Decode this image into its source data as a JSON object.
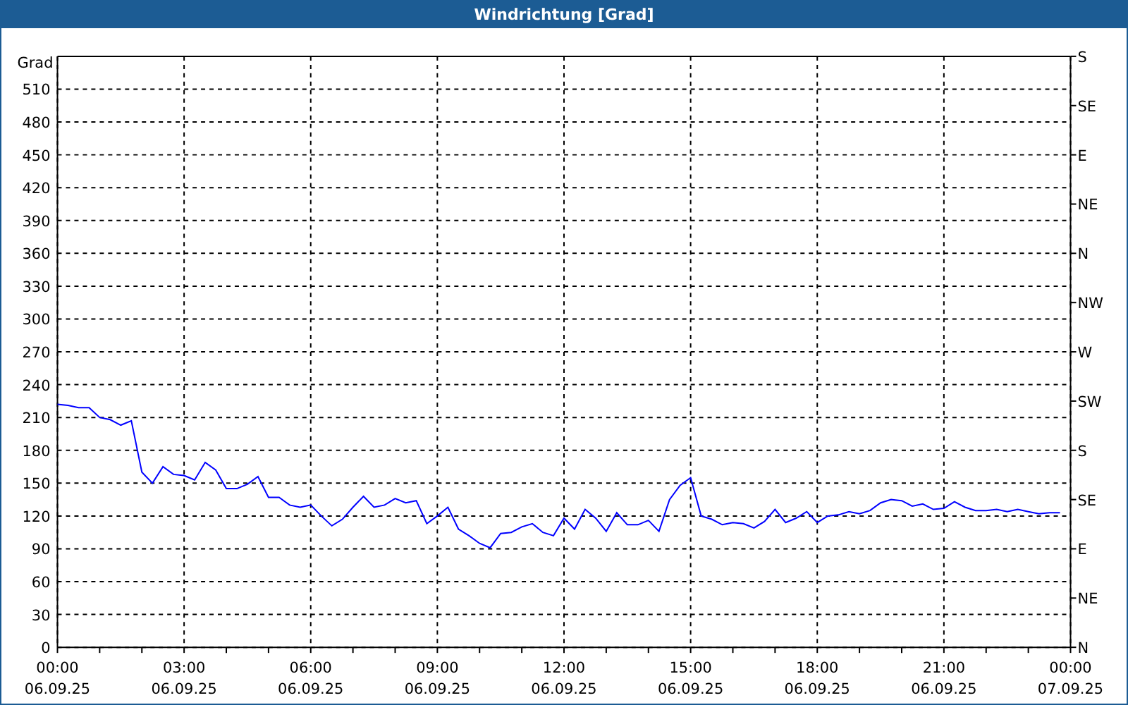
{
  "window": {
    "title": "Windrichtung [Grad]"
  },
  "chart": {
    "chart_data": {
      "type": "line",
      "grid": true,
      "ylabel": "Grad",
      "ylim": [
        0,
        540
      ],
      "yticks": [
        0,
        30,
        60,
        90,
        120,
        150,
        180,
        210,
        240,
        270,
        300,
        330,
        360,
        390,
        420,
        450,
        480,
        510
      ],
      "categories": [
        "00:00 06.09.25",
        null,
        null,
        null,
        null,
        null,
        null,
        null,
        null,
        null,
        null,
        null,
        "03:00 06.09.25",
        null,
        null,
        null,
        null,
        null,
        null,
        null,
        null,
        null,
        null,
        null,
        "06:00 06.09.25",
        null,
        null,
        null,
        null,
        null,
        null,
        null,
        null,
        null,
        null,
        null,
        "09:00 06.09.25",
        null,
        null,
        null,
        null,
        null,
        null,
        null,
        null,
        null,
        null,
        null,
        "12:00 06.09.25",
        null,
        null,
        null,
        null,
        null,
        null,
        null,
        null,
        null,
        null,
        null,
        "15:00 06.09.25",
        null,
        null,
        null,
        null,
        null,
        null,
        null,
        null,
        null,
        null,
        null,
        "18:00 06.09.25",
        null,
        null,
        null,
        null,
        null,
        null,
        null,
        null,
        null,
        null,
        null,
        "21:00 06.09.25",
        null,
        null,
        null,
        null,
        null,
        null,
        null,
        null,
        null,
        null,
        null,
        "00:00 07.09.25"
      ],
      "series": [
        {
          "color": "#0000ff",
          "values": [
            222,
            221,
            219,
            219,
            210,
            208,
            203,
            207,
            160,
            150,
            165,
            158,
            157,
            153,
            169,
            162,
            145,
            145,
            149,
            156,
            137,
            137,
            130,
            128,
            130,
            120,
            111,
            117,
            128,
            138,
            128,
            130,
            136,
            132,
            134,
            113,
            120,
            128,
            108,
            102,
            95,
            91,
            104,
            105,
            110,
            113,
            105,
            102,
            118,
            108,
            126,
            118,
            106,
            123,
            112,
            112,
            116,
            106,
            135,
            148,
            155,
            120,
            117,
            112,
            114,
            113,
            109,
            115,
            126,
            114,
            118,
            124,
            114,
            120,
            121,
            124,
            122,
            125,
            132,
            135,
            134,
            129,
            131,
            126,
            127,
            133,
            128,
            125,
            125,
            126,
            124,
            126,
            124,
            122,
            123,
            123,
            null
          ]
        }
      ]
    },
    "right_axis_labels": [
      "S",
      "SE",
      "E",
      "NE",
      "N",
      "NW",
      "W",
      "SW",
      "S",
      "SE",
      "E",
      "NE",
      "N"
    ]
  }
}
